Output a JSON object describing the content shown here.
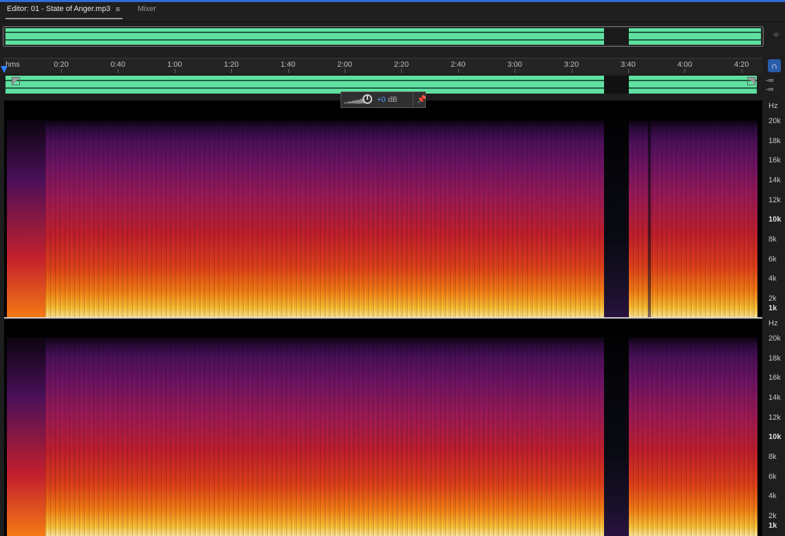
{
  "tabs": {
    "editor_label": "Editor: 01 - State of Anger.mp3",
    "menu_icon": "≡",
    "mixer_label": "Mixer"
  },
  "ruler": {
    "units": "hms",
    "ticks": [
      "0:20",
      "0:40",
      "1:00",
      "1:20",
      "1:40",
      "2:00",
      "2:20",
      "2:40",
      "3:00",
      "3:20",
      "3:40",
      "4:00",
      "4:20"
    ]
  },
  "levels": {
    "top_db": "-∞",
    "bottom_db": "-∞"
  },
  "hud": {
    "value": "+0",
    "unit": "dB"
  },
  "frequency_axis": {
    "unit": "Hz",
    "labels": [
      "20k",
      "18k",
      "16k",
      "14k",
      "12k",
      "10k",
      "8k",
      "6k",
      "4k",
      "2k",
      "1k"
    ]
  },
  "colors": {
    "accent": "#2d6fd6",
    "waveform": "#5fe0a0",
    "hud_value": "#4aa0ff"
  },
  "icons": {
    "snap": "snap-magnet-icon",
    "pin": "pin-icon",
    "navigator": "zoom-navigator-icon",
    "knob": "volume-knob-icon"
  }
}
